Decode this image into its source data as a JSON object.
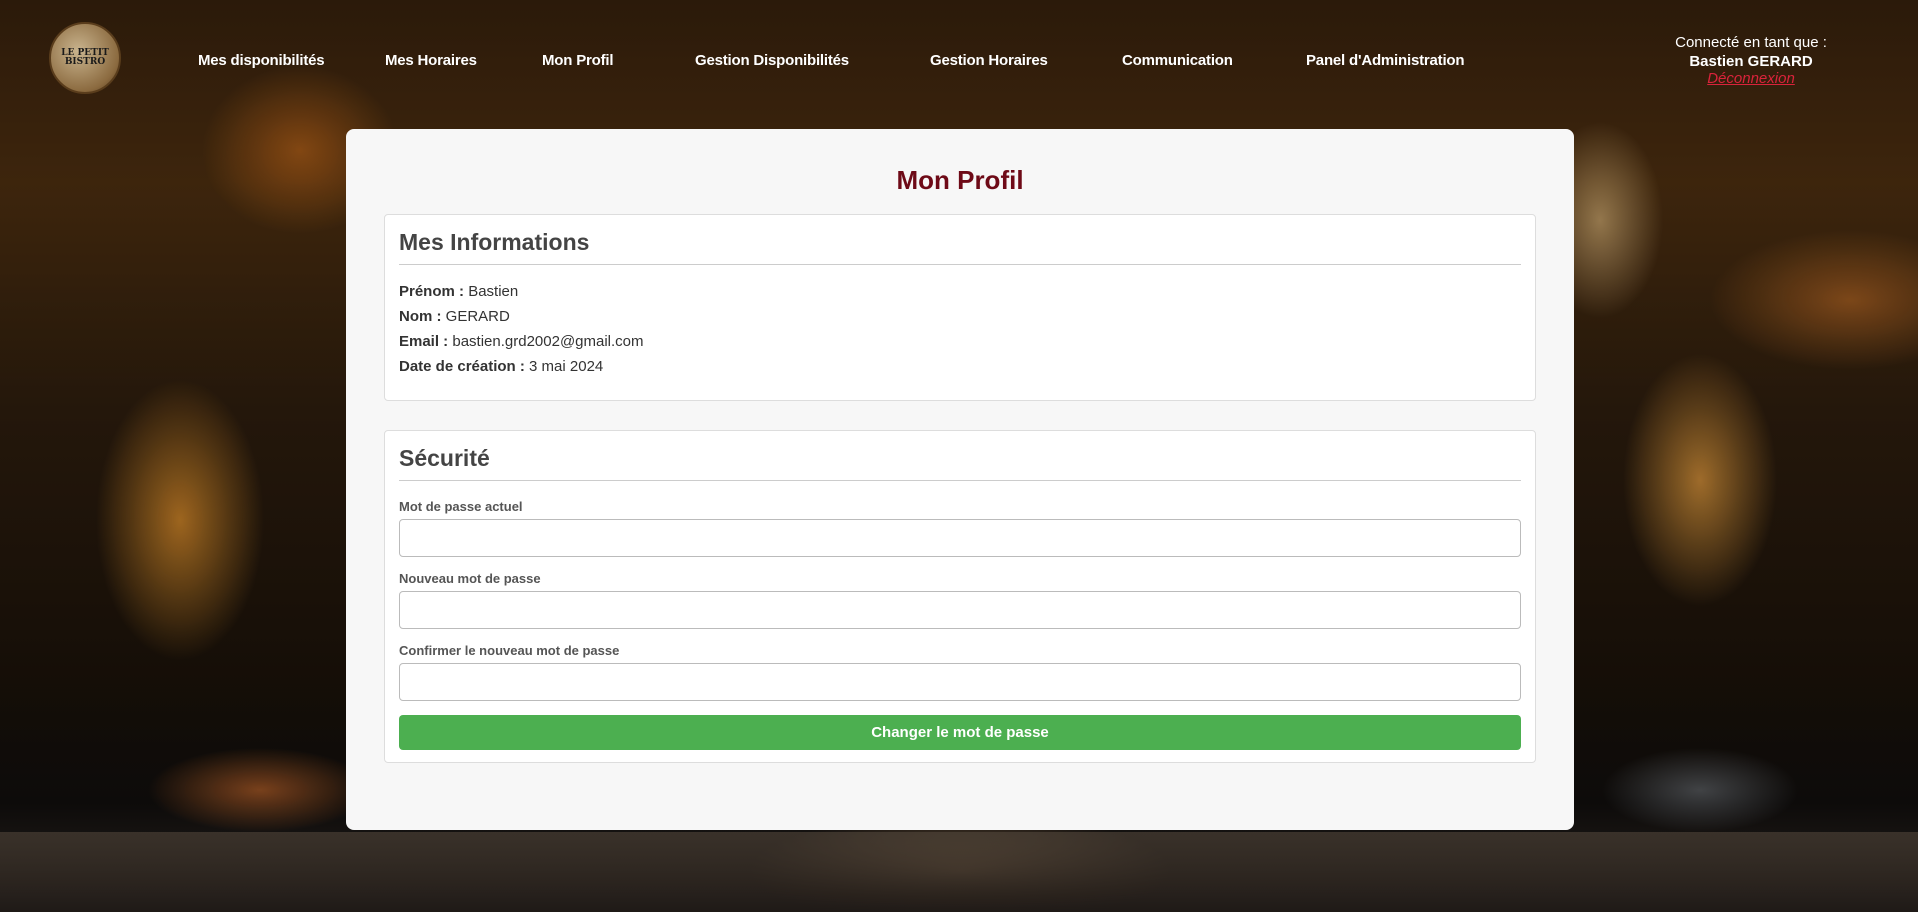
{
  "logo": {
    "text": "LE PETIT BISTRO",
    "icon": "bistro-logo"
  },
  "nav": {
    "items": [
      {
        "label": "Mes disponibilités"
      },
      {
        "label": "Mes Horaires"
      },
      {
        "label": "Mon Profil"
      },
      {
        "label": "Gestion Disponibilités"
      },
      {
        "label": "Gestion Horaires"
      },
      {
        "label": "Communication"
      },
      {
        "label": "Panel d'Administration"
      }
    ]
  },
  "user": {
    "label": "Connecté en tant que :",
    "name": "Bastien GERARD",
    "logout": "Déconnexion"
  },
  "page": {
    "title": "Mon Profil"
  },
  "info": {
    "title": "Mes Informations",
    "firstname_label": "Prénom :",
    "firstname": "Bastien",
    "lastname_label": "Nom :",
    "lastname": "GERARD",
    "email_label": "Email :",
    "email": "bastien.grd2002@gmail.com",
    "created_label": "Date de création :",
    "created": "3 mai 2024"
  },
  "security": {
    "title": "Sécurité",
    "current_label": "Mot de passe actuel",
    "current_value": "",
    "new_label": "Nouveau mot de passe",
    "new_value": "",
    "confirm_label": "Confirmer le nouveau mot de passe",
    "confirm_value": "",
    "submit_label": "Changer le mot de passe"
  },
  "colors": {
    "title": "#6e0a17",
    "submit": "#4caf50",
    "logout": "#d9233b"
  }
}
